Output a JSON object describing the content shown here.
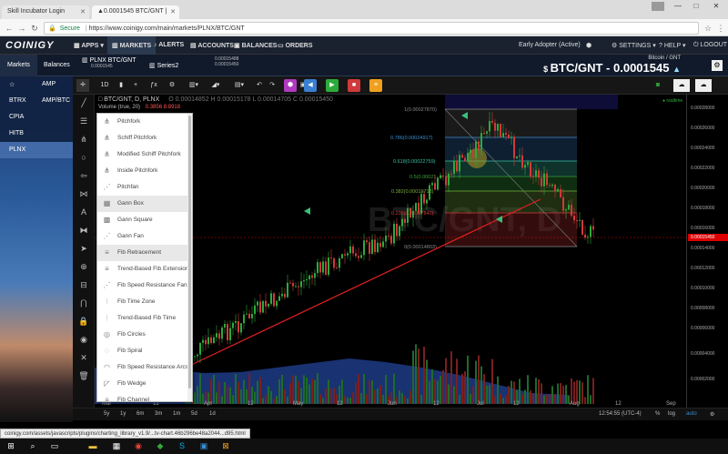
{
  "browser": {
    "tabs": [
      {
        "title": "Skill Incubator Login",
        "active": false
      },
      {
        "title": "▲0.0001545 BTC/GNT |",
        "active": true
      }
    ],
    "secure_label": "Secure",
    "url": "https://www.coinigy.com/main/markets/PLNX/BTC/GNT"
  },
  "app": {
    "logo": "COINIGY",
    "nav": [
      {
        "label": "APPS",
        "icon": "grid-icon"
      },
      {
        "label": "MARKETS",
        "icon": "chart-icon",
        "active": true
      },
      {
        "label": "ALERTS",
        "icon": "bell-icon"
      },
      {
        "label": "ACCOUNTS",
        "icon": "bank-icon"
      },
      {
        "label": "BALANCES",
        "icon": "wallet-icon"
      },
      {
        "label": "ORDERS",
        "icon": "cart-icon"
      }
    ],
    "account_status": "Early Adopter (Active)",
    "right_nav": [
      {
        "label": "SETTINGS",
        "icon": "gear-icon"
      },
      {
        "label": "HELP",
        "icon": "question-icon"
      },
      {
        "label": "LOGOUT",
        "icon": "power-icon"
      }
    ]
  },
  "subheader": {
    "side_tabs": [
      "Markets",
      "Balances"
    ],
    "market_tabs": [
      {
        "name": "PLNX BTC/GNT",
        "sub": "0.0001545"
      },
      {
        "name": "Series2",
        "sub": ""
      },
      {
        "name": "0.00015488",
        "sub": "0.00015450"
      }
    ],
    "pair_label": "Bitcoin / GNT",
    "price": "BTC/GNT - 0.0001545",
    "price_arrow": "▲"
  },
  "sidebar": {
    "rows": [
      {
        "icon": "star-icon",
        "left": "☆",
        "right": "AMP"
      },
      {
        "left": "BTRX",
        "right": "AMP/BTC"
      },
      {
        "left": "CPIA",
        "right": ""
      },
      {
        "left": "HITB",
        "right": ""
      },
      {
        "left": "PLNX",
        "right": ""
      }
    ]
  },
  "toolbar": {
    "interval": "1D",
    "buttons": [
      "+",
      "⚙"
    ],
    "colored_buttons": [
      {
        "icon": "cube-icon",
        "color": "#b03abf"
      },
      {
        "icon": "megaphone-icon",
        "color": "#3a7fd0"
      },
      {
        "icon": "play-icon",
        "color": "#2eaa3a"
      },
      {
        "icon": "stop-icon",
        "color": "#d03a3a"
      },
      {
        "icon": "list-icon",
        "color": "#f0a020"
      }
    ]
  },
  "chart_header": {
    "symbol": "BTC/GNT, D, PLNX",
    "ohlc": "O 0.00014852  H 0.00015178  L 0.00014705  C 0.00015450",
    "volume": "Volume (true, 20)",
    "vol_value": "0.3856  8.8918",
    "realtime": "realtime"
  },
  "drawing_menu": {
    "items": [
      {
        "label": "Pitchfork",
        "icon": "pitchfork-icon"
      },
      {
        "label": "Schiff Pitchfork",
        "icon": "schiff-pitchfork-icon"
      },
      {
        "label": "Modified Schiff Pitchfork",
        "icon": "modified-schiff-pitchfork-icon"
      },
      {
        "label": "Inside Pitchfork",
        "icon": "inside-pitchfork-icon"
      },
      {
        "label": "Pitchfan",
        "icon": "pitchfan-icon"
      },
      {
        "label": "Gann Box",
        "icon": "gann-box-icon",
        "highlight": true
      },
      {
        "label": "Gann Square",
        "icon": "gann-square-icon"
      },
      {
        "label": "Gann Fan",
        "icon": "gann-fan-icon"
      },
      {
        "label": "Fib Retracement",
        "icon": "fib-retracement-icon",
        "highlight": true
      },
      {
        "label": "Trend-Based Fib Extension",
        "icon": "fib-extension-icon"
      },
      {
        "label": "Fib Speed Resistance Fan",
        "icon": "fib-speed-fan-icon"
      },
      {
        "label": "Fib Time Zone",
        "icon": "fib-time-zone-icon"
      },
      {
        "label": "Trend-Based Fib Time",
        "icon": "fib-time-icon"
      },
      {
        "label": "Fib Circles",
        "icon": "fib-circles-icon"
      },
      {
        "label": "Fib Spiral",
        "icon": "fib-spiral-icon"
      },
      {
        "label": "Fib Speed Resistance Arcs",
        "icon": "fib-arcs-icon"
      },
      {
        "label": "Fib Wedge",
        "icon": "fib-wedge-icon"
      },
      {
        "label": "Fib Channel",
        "icon": "fib-channel-icon"
      }
    ]
  },
  "fib_levels": [
    {
      "label": "1(0.00027870)",
      "color": "#888888"
    },
    {
      "label": "0.786(0.00024917)",
      "color": "#3a8fd0"
    },
    {
      "label": "0.618(0.00022759)",
      "color": "#3ac0a0"
    },
    {
      "label": "0.5(0.00021...)",
      "color": "#3aa03a"
    },
    {
      "label": "0.382(0.00019718)",
      "color": "#7ab03a"
    },
    {
      "label": "0.236(0.00017840)",
      "color": "#d03a3a"
    },
    {
      "label": "0(0.00014803)",
      "color": "#888888"
    }
  ],
  "yaxis": {
    "labels": [
      "0.00028000",
      "0.00026000",
      "0.00024000",
      "0.00022000",
      "0.00020000",
      "0.00018000",
      "0.00016000",
      "0.00014000",
      "0.00012000",
      "0.00010000",
      "0.00008000",
      "0.00006000",
      "0.00004000",
      "0.00002000"
    ],
    "current": "0.00015450"
  },
  "xaxis": {
    "labels": [
      "Mar",
      "12",
      "Apr",
      "12",
      "May",
      "12",
      "Jun",
      "12",
      "Jul",
      "12",
      "Aug",
      "12",
      "Sep"
    ]
  },
  "bottombar": {
    "ranges": [
      "5y",
      "1y",
      "6m",
      "3m",
      "1m",
      "5d",
      "1d"
    ],
    "time": "12:54:55 (UTC-4)",
    "modes": [
      "%",
      "log",
      "auto"
    ]
  },
  "status_url": "coinigy.com/assets/javascripts/plugins/charting_library_v1.9/...tv-chart.46b296be48a2044...d95.html",
  "taskbar": {
    "icons": [
      "windows-icon",
      "search-icon",
      "task-view-icon",
      "explorer-icon",
      "chrome-icon",
      "camtasia-icon",
      "skype-icon",
      "mail-icon",
      "photos-icon",
      "app-icon"
    ]
  }
}
